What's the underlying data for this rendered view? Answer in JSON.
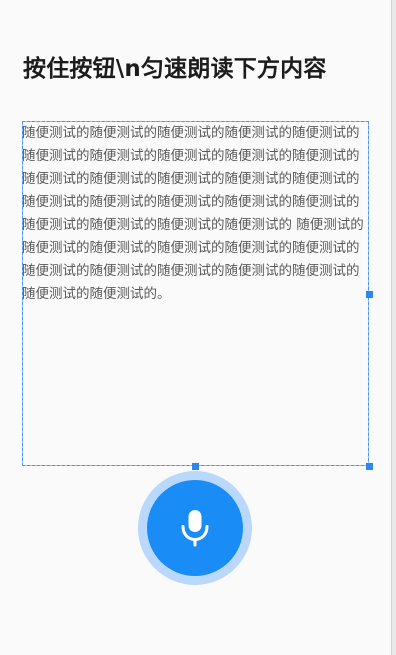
{
  "header": {
    "title": "按住按钮\\n匀速朗读下方内容"
  },
  "reading": {
    "passage": "随便测试的随便测试的随便测试的随便测试的随便测试的随便测试的随便测试的随便测试的随便测试的随便测试的 随便测试的随便测试的随便测试的随便测试的随便测试的随便测试的随便测试的随便测试的随便测试的随便测试的随便测试的随便测试的随便测试的随便测试的 随便测试的随便测试的随便测试的随便测试的随便测试的随便测试的随便测试的随便测试的随便测试的随便测试的随便测试的随便测试的随便测试的。"
  },
  "record_button": {
    "icon": "microphone-icon"
  },
  "colors": {
    "accent": "#1a8cf6",
    "accent_ring": "#b9d8fb",
    "selection": "#2f86ef",
    "title_text": "#1c1c1c",
    "body_text": "#595959",
    "background": "#fafafa"
  }
}
